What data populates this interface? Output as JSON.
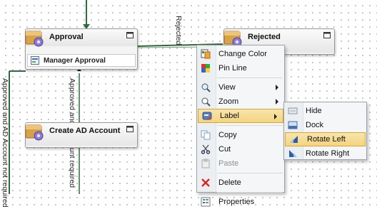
{
  "nodes": {
    "approval": {
      "title": "Approval",
      "sub_label": "Manager Approval"
    },
    "rejected": {
      "title": "Rejected"
    },
    "create_ad": {
      "title": "Create AD Account"
    }
  },
  "connector_labels": {
    "rejected": "Rejected",
    "approved_and": "Approved and",
    "unt_required": "unt required",
    "left_long": "Approved and AD Account not required"
  },
  "context_menu": {
    "items": [
      {
        "label": "Change Color",
        "icon": "color-palette-icon"
      },
      {
        "label": "Pin Line",
        "icon": "grid-pin-icon"
      },
      {
        "label": "View",
        "icon": "magnifier-icon",
        "submenu": true
      },
      {
        "label": "Zoom",
        "icon": "zoom-icon",
        "submenu": true
      },
      {
        "label": "Label",
        "icon": "label-icon",
        "submenu": true,
        "highlighted": true
      },
      {
        "label": "Copy",
        "icon": "copy-icon"
      },
      {
        "label": "Cut",
        "icon": "scissors-icon"
      },
      {
        "label": "Paste",
        "icon": "paste-icon",
        "disabled": true
      },
      {
        "label": "Delete",
        "icon": "delete-x-icon"
      },
      {
        "label": "Properties",
        "icon": "properties-icon"
      }
    ]
  },
  "label_submenu": {
    "items": [
      {
        "label": "Hide",
        "icon": "hide-icon"
      },
      {
        "label": "Dock",
        "icon": "dock-icon"
      },
      {
        "label": "Rotate Left",
        "icon": "rotate-left-icon",
        "highlighted": true
      },
      {
        "label": "Rotate Right",
        "icon": "rotate-right-icon"
      }
    ]
  },
  "colors": {
    "connector_green": "#2e6a3a",
    "highlight": "#f4d47e",
    "menu_bg": "#f4f6f8"
  }
}
